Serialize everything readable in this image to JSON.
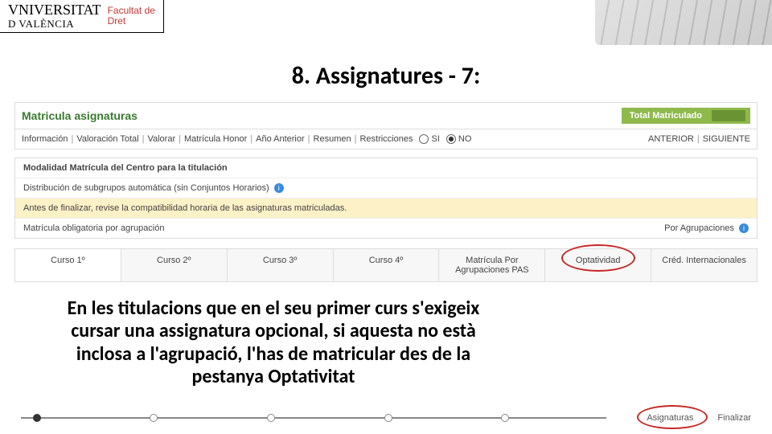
{
  "header": {
    "university_line1": "VNIVERSITAT",
    "university_line2": "D VALÈNCIA",
    "faculty_line1": "Facultat de",
    "faculty_line2": "Dret"
  },
  "slide_title": "8. Assignatures - 7:",
  "app": {
    "title": "Matricula asignaturas",
    "total_label": "Total Matriculado",
    "menu": {
      "items": [
        "Información",
        "Valoración Total",
        "Valorar",
        "Matrícula Honor",
        "Año Anterior",
        "Resumen",
        "Restricciones"
      ],
      "radio_si": "SI",
      "radio_no": "NO",
      "anterior": "ANTERIOR",
      "siguiente": "SIGUIENTE"
    },
    "panel": {
      "title": "Modalidad Matrícula del Centro para la titulación",
      "row1": "Distribución de subgrupos automática (sin Conjuntos Horarios)",
      "row2": "Antes de finalizar, revise la compatibilidad horaria de las asignaturas matriculadas.",
      "row3_left": "Matrícula obligatoria por agrupación",
      "row3_right": "Por Agrupaciones"
    },
    "tabs": [
      "Curso 1º",
      "Curso 2º",
      "Curso 3º",
      "Curso 4º",
      "Matrícula Por Agrupaciones PAS",
      "Optatividad",
      "Créd. Internacionales"
    ],
    "highlighted_tab_index": 5
  },
  "note_text": "En les titulacions que en el seu primer curs s'exigeix cursar una assignatura opcional, si aquesta no està inclosa a l'agrupació, l'has de matricular des de la pestanya Optativitat",
  "footer": {
    "asignaturas": "Asignaturas",
    "finalizar": "Finalizar"
  }
}
